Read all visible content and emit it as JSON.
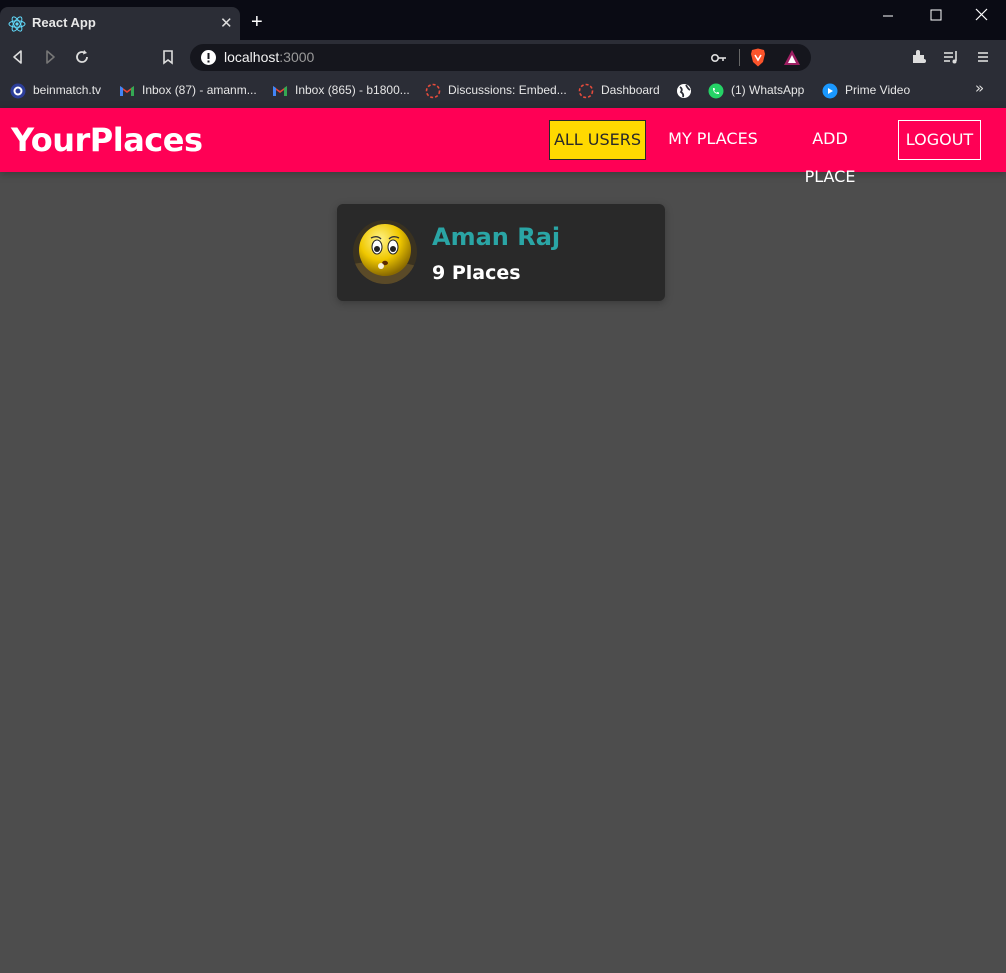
{
  "browser": {
    "tab_title": "React App",
    "new_tab_symbol": "+",
    "url_host": "localhost",
    "url_port": ":3000",
    "bookmarks": [
      {
        "label": "beinmatch.tv",
        "icon": "beinmatch-icon"
      },
      {
        "label": "Inbox (87) - amanm...",
        "icon": "gmail-icon"
      },
      {
        "label": "Inbox (865) - b1800...",
        "icon": "gmail-icon"
      },
      {
        "label": "Discussions: Embed...",
        "icon": "loading-icon"
      },
      {
        "label": "Dashboard",
        "icon": "loading-icon"
      },
      {
        "label": "",
        "icon": "globe-icon"
      },
      {
        "label": "(1) WhatsApp",
        "icon": "whatsapp-icon"
      },
      {
        "label": "Prime Video",
        "icon": "prime-video-icon"
      }
    ],
    "bookmarks_more": "»"
  },
  "app": {
    "brand": "YourPlaces",
    "nav": {
      "all_users": "ALL USERS",
      "my_places": "MY PLACES",
      "add_place": "ADD PLACE",
      "logout": "LOGOUT"
    },
    "users": [
      {
        "name": "Aman Raj",
        "places": "9 Places"
      }
    ]
  },
  "colors": {
    "header": "#ff0055",
    "active_nav": "#ffd900",
    "page_bg": "#4d4d4d",
    "card_bg": "#292929",
    "user_name": "#2aa5a5"
  }
}
